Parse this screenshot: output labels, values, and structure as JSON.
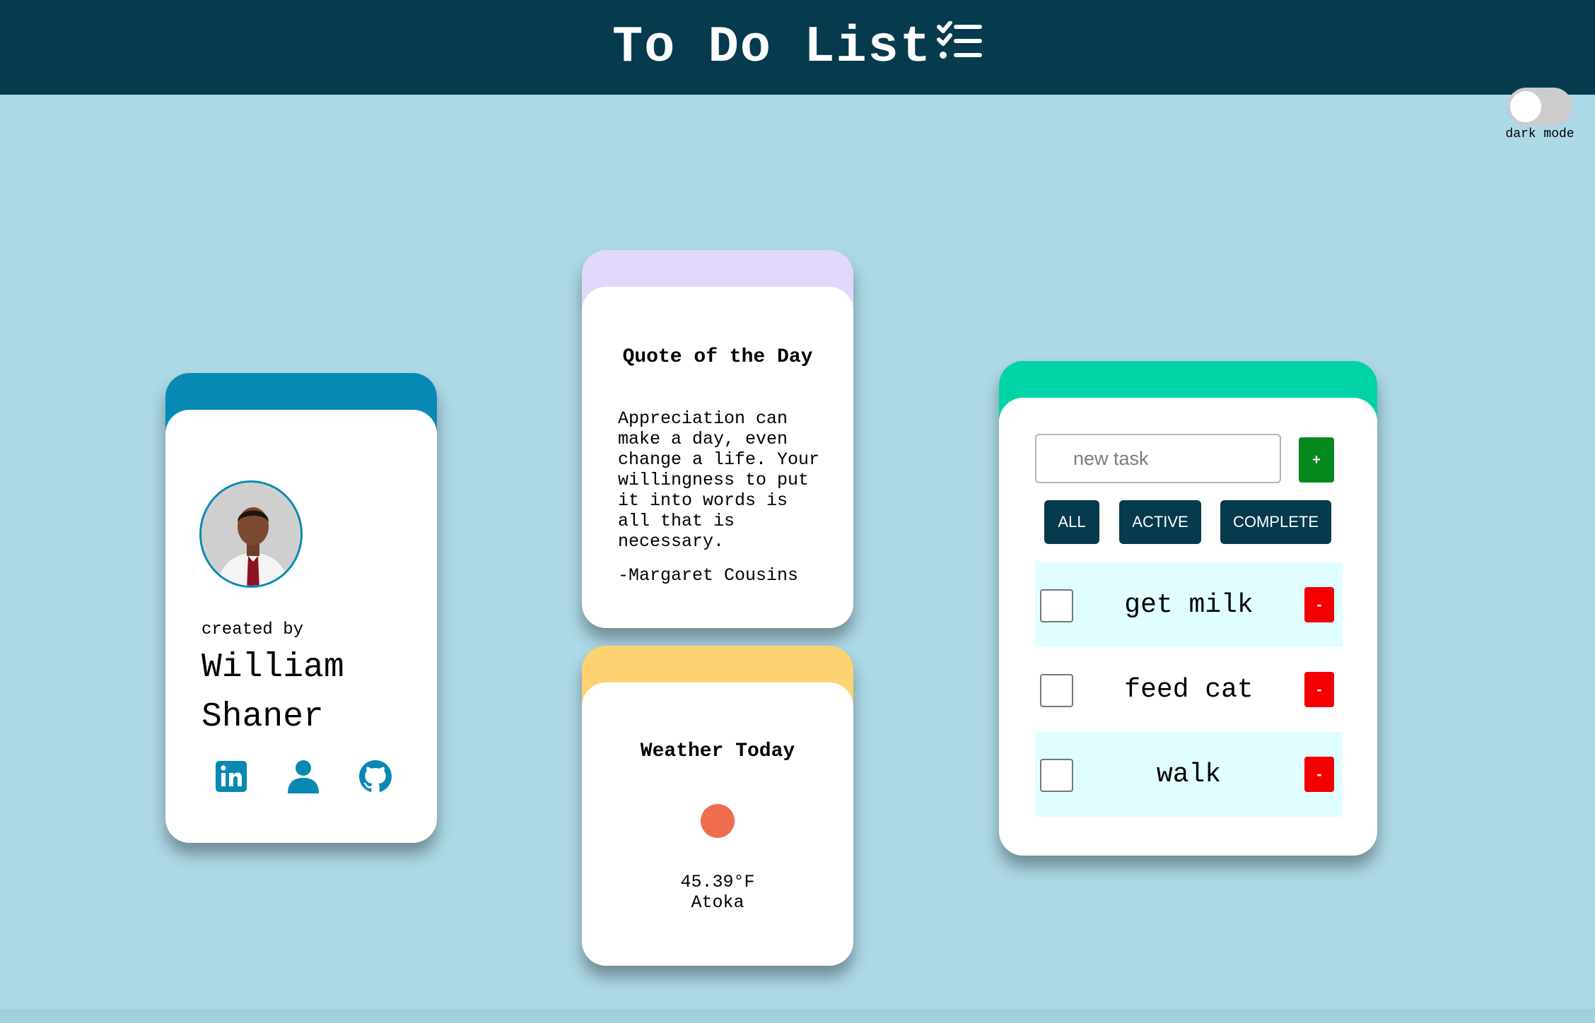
{
  "header": {
    "title": "To Do List",
    "title_icon": "checklist-icon",
    "background": "#063a4d"
  },
  "dark_mode": {
    "label": "dark mode",
    "enabled": false
  },
  "profile_card": {
    "accent": "#0889b4",
    "created_by_label": "created by",
    "author_name": "William Shaner",
    "avatar_icon": "avatar-photo",
    "social_icons": [
      "linkedin-icon",
      "person-icon",
      "github-icon"
    ]
  },
  "quote_card": {
    "accent": "#e1d8fb",
    "heading": "Quote of the Day",
    "text": "Appreciation can make a day, even change a life. Your willingness to put it into words is all that is necessary.",
    "author": "-Margaret Cousins"
  },
  "weather_card": {
    "accent": "#fdd272",
    "heading": "Weather Today",
    "icon": "weather-dot-icon",
    "temperature": "45.39°F",
    "city": "Atoka"
  },
  "todo_card": {
    "accent": "#00d4a6",
    "input_placeholder": "new task",
    "input_value": "",
    "add_label": "+",
    "filters": {
      "all": "ALL",
      "active": "ACTIVE",
      "complete": "COMPLETE"
    },
    "tasks": [
      {
        "label": "get milk",
        "done": false,
        "remove_label": "-"
      },
      {
        "label": "feed cat",
        "done": false,
        "remove_label": "-"
      },
      {
        "label": "walk",
        "done": false,
        "remove_label": "-"
      }
    ]
  }
}
